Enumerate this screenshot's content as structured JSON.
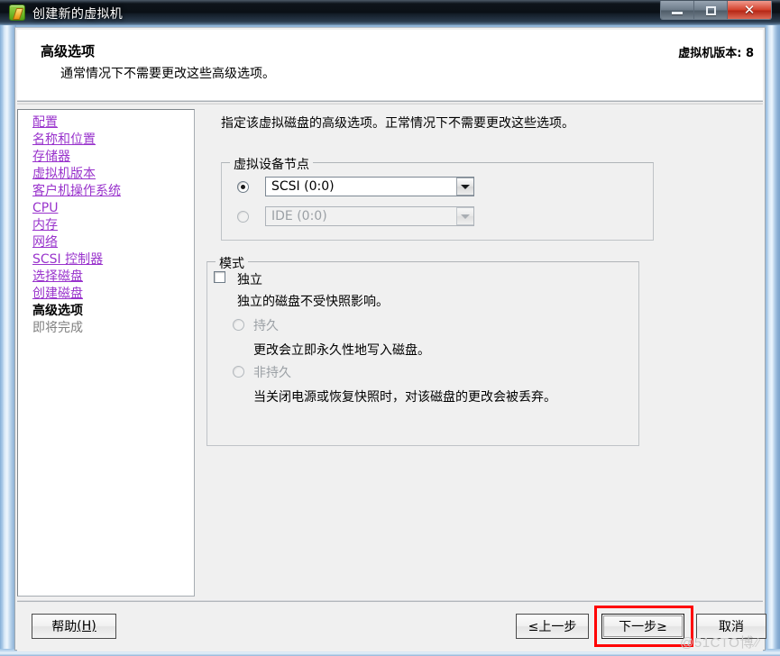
{
  "window": {
    "title": "创建新的虚拟机",
    "icon": "vm-icon",
    "controls": {
      "minimize": "minimize-icon",
      "maximize": "maximize-icon",
      "close": "close-icon"
    }
  },
  "header": {
    "title": "高级选项",
    "subtitle": "通常情况下不需要更改这些高级选项。",
    "version_label": "虚拟机版本: 8"
  },
  "sidebar": {
    "items": [
      {
        "label": "配置",
        "state": "link"
      },
      {
        "label": "名称和位置",
        "state": "link"
      },
      {
        "label": "存储器",
        "state": "link"
      },
      {
        "label": "虚拟机版本",
        "state": "link"
      },
      {
        "label": "客户机操作系统",
        "state": "link"
      },
      {
        "label": "CPU",
        "state": "link"
      },
      {
        "label": "内存",
        "state": "link"
      },
      {
        "label": "网络",
        "state": "link"
      },
      {
        "label": "SCSI 控制器",
        "state": "link"
      },
      {
        "label": "选择磁盘",
        "state": "link"
      },
      {
        "label": "创建磁盘",
        "state": "link"
      },
      {
        "label": "高级选项",
        "state": "current"
      },
      {
        "label": "即将完成",
        "state": "pending"
      }
    ]
  },
  "main": {
    "description": "指定该虚拟磁盘的高级选项。正常情况下不需要更改这些选项。",
    "device_node_group": {
      "title": "虚拟设备节点",
      "scsi": {
        "selected": true,
        "value": "SCSI (0:0)",
        "disabled": false
      },
      "ide": {
        "selected": false,
        "value": "IDE (0:0)",
        "disabled": true
      }
    },
    "mode_group": {
      "title": "模式",
      "independent_checkbox": {
        "label": "独立",
        "checked": false
      },
      "independent_desc": "独立的磁盘不受快照影响。",
      "persistent": {
        "label": "持久",
        "desc": "更改会立即永久性地写入磁盘。",
        "selected": false,
        "disabled": true
      },
      "nonpersistent": {
        "label": "非持久",
        "desc": "当关闭电源或恢复快照时，对该磁盘的更改会被丢弃。",
        "selected": false,
        "disabled": true
      }
    }
  },
  "footer": {
    "help": "帮助(H)",
    "help_text": "帮助",
    "help_key": "(H)",
    "back": "≤上一步",
    "next": "下一步≥",
    "cancel": "取消"
  },
  "watermark": {
    "text": "@51CTO博"
  },
  "colors": {
    "link": "#9933cc",
    "annotation": "#ff0000",
    "close_button": "#c0392b",
    "dialog_bg": "#f0f0f0"
  }
}
